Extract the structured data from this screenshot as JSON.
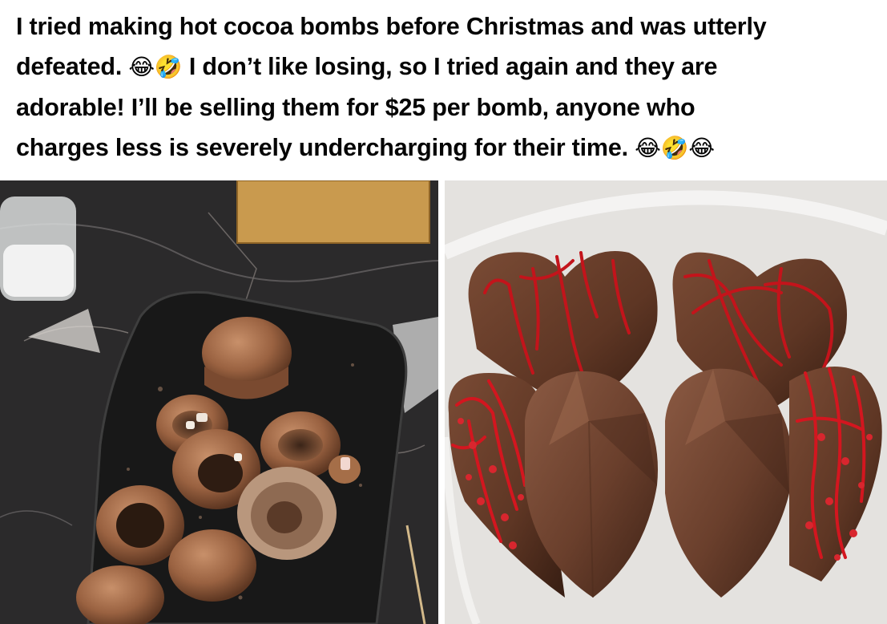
{
  "post": {
    "lines": [
      [
        "I tried making hot cocoa bombs before Christmas and was utterly"
      ],
      [
        "defeated. ",
        "😂🤣",
        "  I don’t like losing, so I tried again and they are"
      ],
      [
        "adorable!  I’ll be selling them for $25 per bomb, anyone who"
      ],
      [
        "charges less is severely undercharging for their time. ",
        "😂🤣😂"
      ]
    ]
  },
  "photos": {
    "left": {
      "icon": "broken-cocoa-bombs-photo"
    },
    "right": {
      "icon": "heart-cocoa-bombs-photo"
    }
  }
}
